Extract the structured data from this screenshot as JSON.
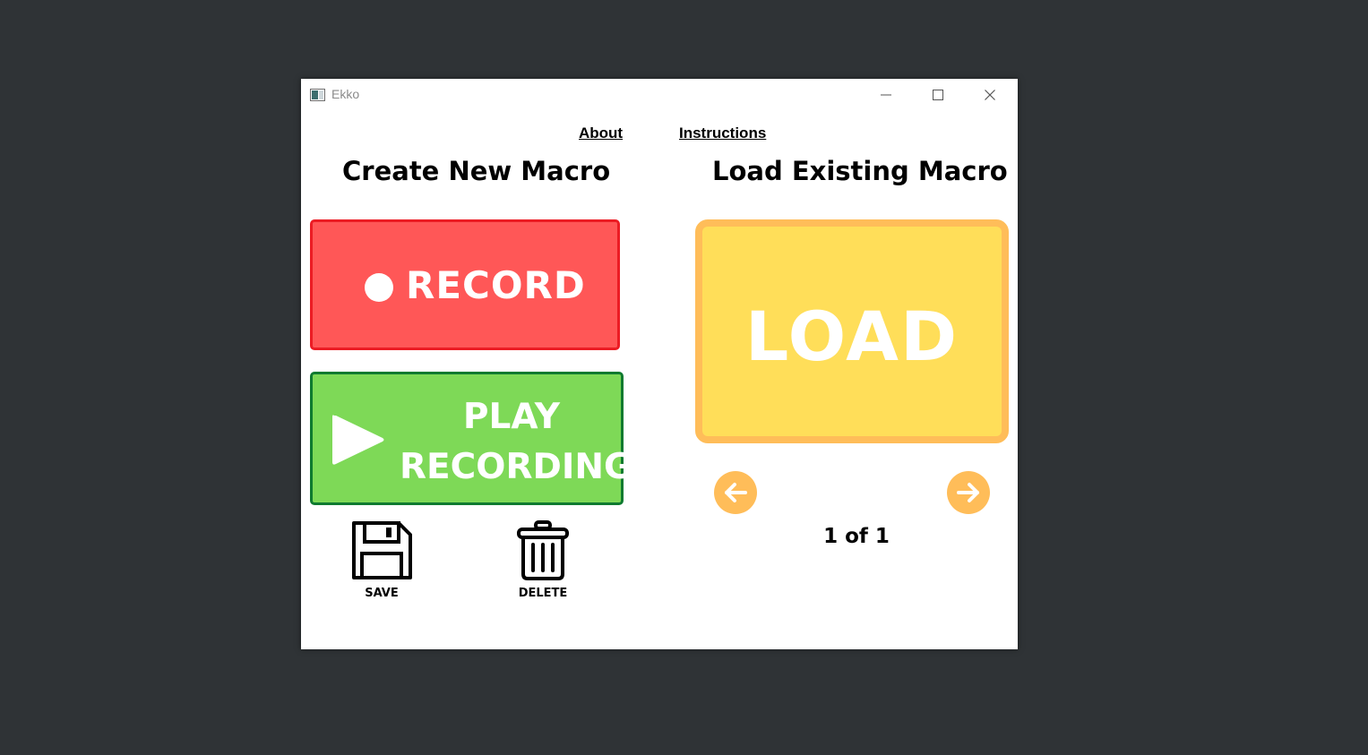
{
  "window": {
    "title": "Ekko",
    "controls": [
      "minimize-icon",
      "maximize-icon",
      "close-icon"
    ]
  },
  "nav": {
    "about": "About",
    "instructions": "Instructions"
  },
  "create_section": {
    "title": "Create New Macro",
    "record_label": "RECORD",
    "play_label": "PLAY\nRECORDING",
    "save_label": "SAVE",
    "delete_label": "DELETE"
  },
  "load_section": {
    "title": "Load Existing Macro",
    "load_label": "LOAD",
    "page_indicator": "1 of 1",
    "prev_icon": "arrow-left-icon",
    "next_icon": "arrow-right-icon"
  },
  "colors": {
    "desktop": "#2f3336",
    "record": "#ff5757",
    "record_border": "#ec1c24",
    "play": "#7ed957",
    "play_border": "#0f7a30",
    "load": "#ffde59",
    "load_border": "#ffbd59",
    "arrow": "#ffbd59"
  }
}
